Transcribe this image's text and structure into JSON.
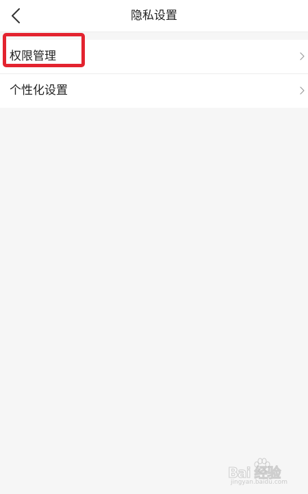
{
  "header": {
    "title": "隐私设置",
    "back_icon": "chevron-left-icon"
  },
  "settings": {
    "items": [
      {
        "label": "权限管理",
        "icon": "chevron-right-icon"
      },
      {
        "label": "个性化设置",
        "icon": "chevron-right-icon"
      }
    ]
  },
  "annotation": {
    "highlight_color": "#e3232f"
  },
  "watermark": {
    "brand": "Bai 经验",
    "url": "jingyan.baidu.com"
  },
  "colors": {
    "page_background": "#f6f6f6",
    "surface": "#ffffff",
    "divider": "#ececec",
    "text_primary": "#222222"
  }
}
